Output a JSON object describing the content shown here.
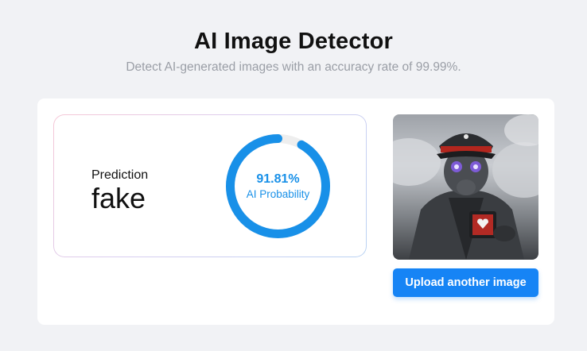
{
  "header": {
    "title": "AI Image Detector",
    "subtitle": "Detect AI-generated images with an accuracy rate of 99.99%."
  },
  "result": {
    "prediction_label": "Prediction",
    "prediction_value": "fake",
    "probability_text": "91.81%",
    "probability_value": 0.9181,
    "probability_label": "AI Probability"
  },
  "preview": {
    "alt": "Uploaded image: gas-mask soldier holding a mug"
  },
  "actions": {
    "upload_label": "Upload another image"
  },
  "colors": {
    "accent": "#1684f5",
    "gauge": "#1890e8",
    "gauge_track": "#eeeeee"
  }
}
